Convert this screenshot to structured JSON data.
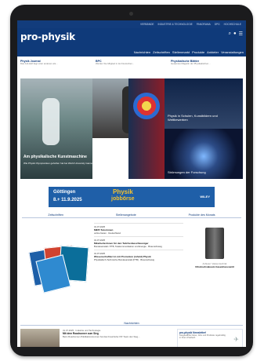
{
  "topbar": {
    "links": [
      "VERBÄNDE",
      "INDUSTRIE & TECHNOLOGIE",
      "PANORAMA",
      "DPG",
      "HOCHSCHULE"
    ]
  },
  "header": {
    "logo": "pro-physik",
    "nav": [
      "Nachrichten",
      "Zeitschriften",
      "Stellenmarkt",
      "Produkte",
      "Anbieter",
      "Veranstaltungen"
    ],
    "icons": [
      "search-icon",
      "user-icon",
      "menu-icon"
    ]
  },
  "teasers": [
    {
      "title": "Physik Journal",
      "text": "Das Juli-Heft liegt unter anderem als..."
    },
    {
      "title": "BPC",
      "text": "Werden Sie Mitglied in der Deutschen..."
    },
    {
      "title": "Physikalische Blätter",
      "text": "Gesamtes Magazin der Physikalischen..."
    }
  ],
  "mosaic": {
    "feature_title": "Am physikalische Kunstmaschine",
    "feature_text": "Wie Physik Olympioniken geholfen hat bei World University Games...",
    "tile_right_title": "Physik in Schulen, Kunstbildern und Wettbewerben",
    "tile_bottom_title": "Strömungen der Forschung"
  },
  "banner": {
    "city": "Göttingen",
    "dates": "8.+ 11.9.2025",
    "brand1": "Physik",
    "brand2": "jobbörse",
    "partner": "WILEY"
  },
  "tabs": [
    "Zeitschriften",
    "Stellenangebote",
    "Produkte des Monats"
  ],
  "jobs": [
    {
      "date": "31.07.2025",
      "title": "MINT-Tutorinnen",
      "text": "online bieten · Deutschland"
    },
    {
      "date": "31.07.2025",
      "title": "Mitarbeiterinnen für den Teilchenbeschleuniger",
      "text": "Bundesanstalt / PTB, Telekommunikation und Energie · Braunschweig"
    },
    {
      "date": "31.07.2025",
      "title": "Wissenschaftler/-in mit Promotion (m/w/d) Physik",
      "text": "Physikalisch-Technische Bundesanstalt (PTB) · Braunschweig"
    }
  ],
  "product": {
    "caption": "Ultrahochvakuum Gaseinlassventil",
    "vendor": "Anbieter: Vakuumtechnik"
  },
  "news": {
    "section": "Nachrichten",
    "date": "31.07.2025 · Industrie und Technologie",
    "title": "Mit dem Roadrunner zum Sieg",
    "text": "Beim Roadrunner-Prädikationsrennen hat das Fraunhofer-IST-Team den Sieg...",
    "newsletter_title": "pro-physik Newsletter!",
    "newsletter_text": "Ausgewählte News, Jobs und Produkte regelmäßig in Ihrem Postfach."
  },
  "colors": {
    "brand": "#0f3a7a",
    "accent": "#1f5fa8"
  }
}
